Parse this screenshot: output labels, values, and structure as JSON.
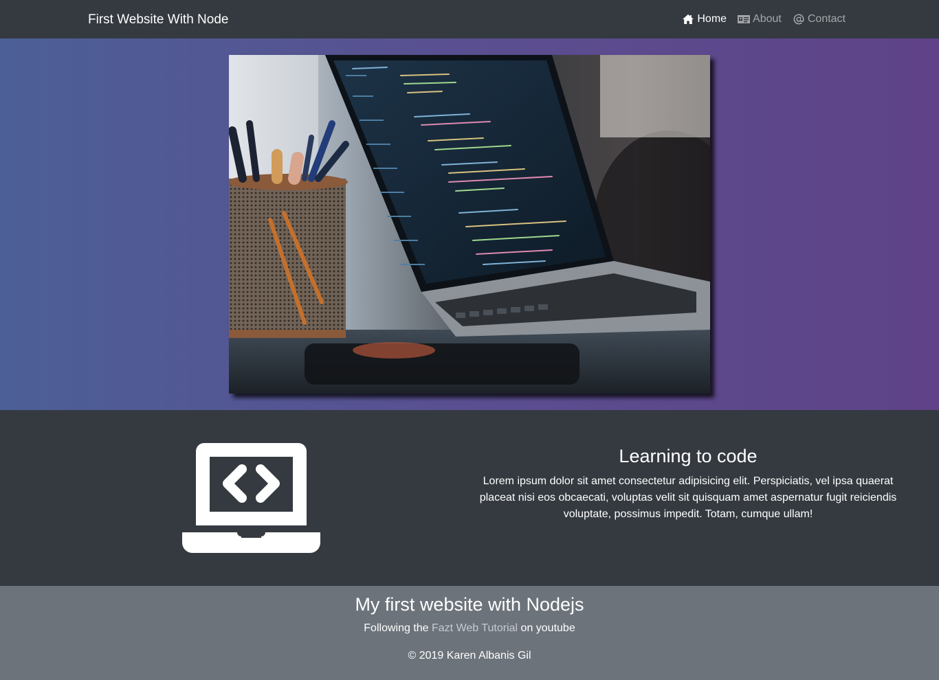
{
  "navbar": {
    "brand": "First Website With Node",
    "links": [
      {
        "label": "Home",
        "icon": "home-icon",
        "active": true
      },
      {
        "label": "About",
        "icon": "id-card-icon",
        "active": false
      },
      {
        "label": "Contact",
        "icon": "at-icon",
        "active": false
      }
    ]
  },
  "hero": {
    "image": "laptop-with-code-photo",
    "gradient": [
      "#4c5f96",
      "#5f4287"
    ]
  },
  "feature": {
    "icon": "laptop-code-icon",
    "title": "Learning to code",
    "body": "Lorem ipsum dolor sit amet consectetur adipisicing elit. Perspiciatis, vel ipsa quaerat placeat nisi eos obcaecati, voluptas velit sit quisquam amet aspernatur fugit reiciendis voluptate, possimus impedit. Totam, cumque ullam!"
  },
  "footer": {
    "title": "My first website with Nodejs",
    "sub_prefix": "Following the ",
    "link_text": "Fazt Web Tutorial",
    "sub_suffix": " on youtube",
    "copyright": "© 2019 Karen Albanis Gil"
  },
  "colors": {
    "navbar_bg": "#343a40",
    "feature_bg": "#343a40",
    "footer_bg": "#6c737b"
  }
}
